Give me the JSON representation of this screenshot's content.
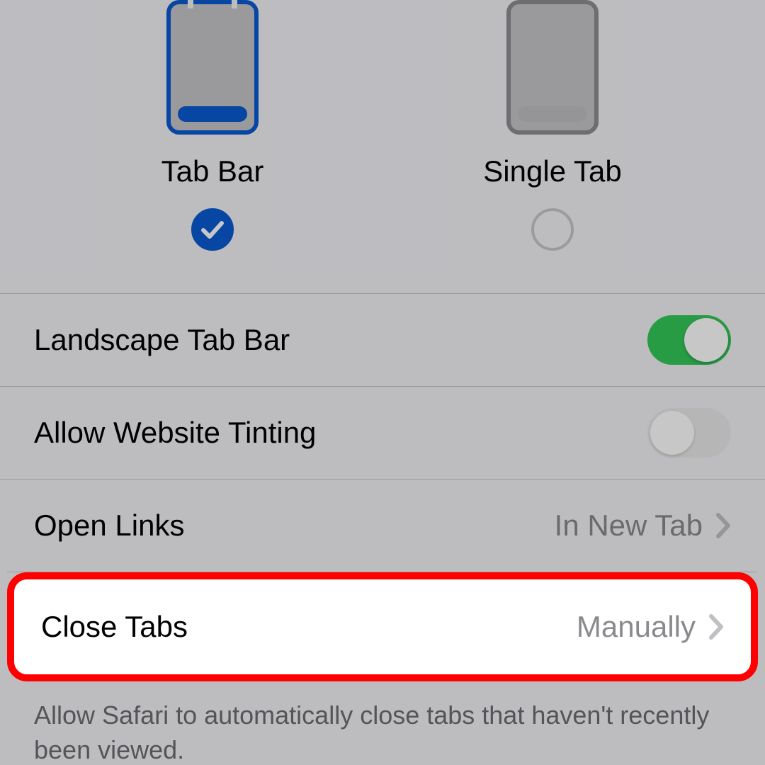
{
  "layout": {
    "options": [
      {
        "label": "Tab Bar",
        "selected": true
      },
      {
        "label": "Single Tab",
        "selected": false
      }
    ]
  },
  "rows": {
    "landscape": {
      "label": "Landscape Tab Bar",
      "on": true
    },
    "tinting": {
      "label": "Allow Website Tinting",
      "on": false
    },
    "open_links": {
      "label": "Open Links",
      "value": "In New Tab"
    },
    "close_tabs": {
      "label": "Close Tabs",
      "value": "Manually"
    }
  },
  "footer": "Allow Safari to automatically close tabs that haven't recently been viewed.",
  "colors": {
    "accent": "#0a5ad0",
    "switch_on": "#34c759",
    "highlight_border": "#ff0000"
  }
}
